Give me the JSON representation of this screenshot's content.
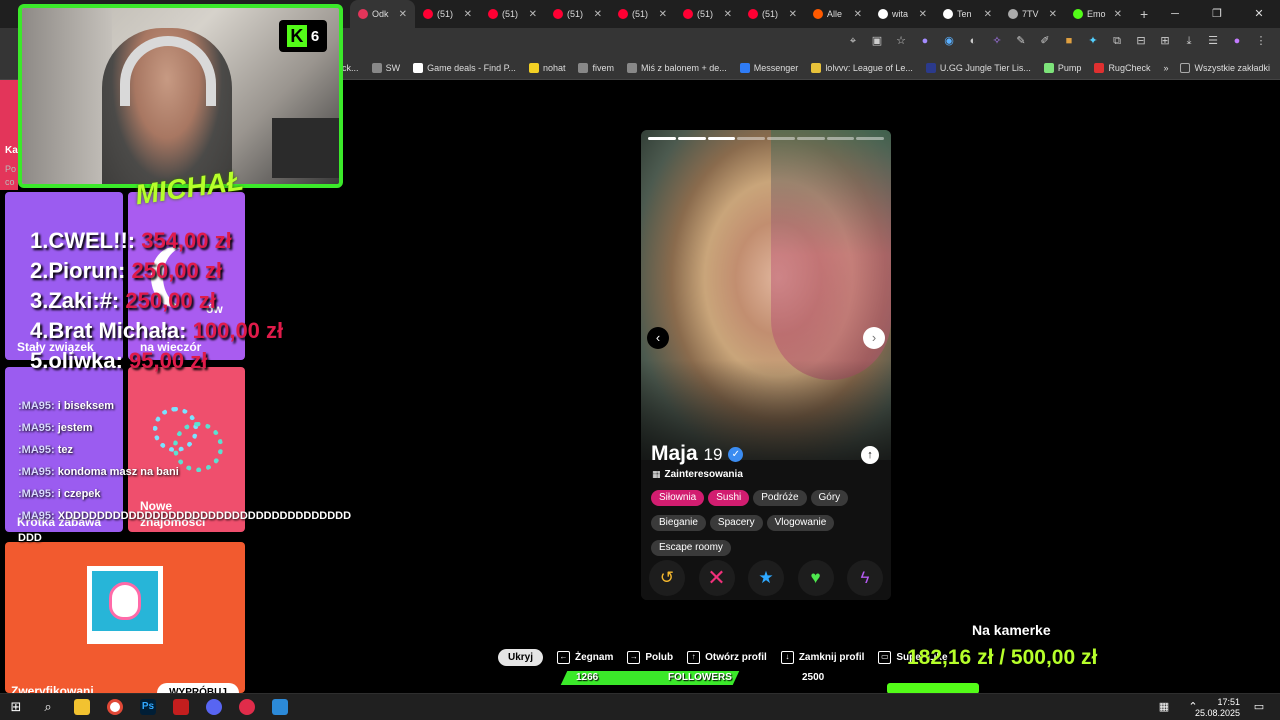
{
  "tabs": [
    {
      "label": "Odk",
      "color": "#e3355a",
      "active": true
    },
    {
      "label": "(51)",
      "color": "#ff0033"
    },
    {
      "label": "(51)",
      "color": "#ff0033"
    },
    {
      "label": "(51)",
      "color": "#ff0033"
    },
    {
      "label": "(51)",
      "color": "#ff0033"
    },
    {
      "label": "(51)",
      "color": "#ff0033"
    },
    {
      "label": "(51)",
      "color": "#ff0033"
    },
    {
      "label": "Alle",
      "color": "#ff5a00"
    },
    {
      "label": "wita",
      "color": "#ffffff"
    },
    {
      "label": "Ten",
      "color": "#ffffff"
    },
    {
      "label": "7TV",
      "color": "#aaaaaa"
    },
    {
      "label": "Emo",
      "color": "#53fc18"
    }
  ],
  "bookmarks": [
    {
      "label": "lock...",
      "color": "#888888"
    },
    {
      "label": "SW",
      "color": "#888888"
    },
    {
      "label": "Game deals - Find P...",
      "color": "#ffffff"
    },
    {
      "label": "nohat",
      "color": "#f2d024"
    },
    {
      "label": "fivem",
      "color": "#888888"
    },
    {
      "label": "Miś z balonem + de...",
      "color": "#888888"
    },
    {
      "label": "Messenger",
      "color": "#2f7cf6"
    },
    {
      "label": "lolvvv: League of Le...",
      "color": "#e8c23a"
    },
    {
      "label": "U.GG Jungle Tier Lis...",
      "color": "#2b3a8c"
    },
    {
      "label": "Pump",
      "color": "#7de37a"
    },
    {
      "label": "RugCheck",
      "color": "#e03030"
    }
  ],
  "bookmarks_all": "Wszystkie zakładki",
  "left_cards": {
    "card1": "Stały związek",
    "card2_line1": "na wieczór",
    "card2_top": "ów",
    "card3": "Krótka zabawa",
    "card4_line1": "Nowe",
    "card4_line2": "znajomości",
    "card5": "Zweryfikowani",
    "card5_btn": "WYPRÓBUJ",
    "edge_label1": "Ka",
    "edge_label2": "Po",
    "edge_label3": "co"
  },
  "webcam": {
    "kick_count": "6",
    "kick_letter": "K"
  },
  "logo": "MICHAŁ",
  "leaderboard": [
    {
      "name": "1.CWEL!!:",
      "amount": "354,00 zł"
    },
    {
      "name": "2.Piorun:",
      "amount": "250,00 zł"
    },
    {
      "name": "3.Zaki:#:",
      "amount": "250,00 zł"
    },
    {
      "name": "4.Brat Michała:",
      "amount": "100,00 zł"
    },
    {
      "name": "5.oliwka:",
      "amount": "95,00 zł"
    }
  ],
  "chat": [
    {
      "user": ":MA95:",
      "text": " i biseksem"
    },
    {
      "user": ":MA95:",
      "text": " jestem"
    },
    {
      "user": ":MA95:",
      "text": " tez"
    },
    {
      "user": ":MA95:",
      "text": " kondoma masz na bani"
    },
    {
      "user": ":MA95:",
      "text": " i czepek"
    },
    {
      "user": ":MA95:",
      "text": " XDDDDDDDDDDDDDDDDDDDDDDDDDDDDDDDDDDDD"
    },
    {
      "user": "",
      "text": "DDD"
    }
  ],
  "profile": {
    "name": "Maja",
    "age": "19",
    "verified_glyph": "✓",
    "interests_title": "Zainteresowania",
    "tags": [
      {
        "label": "Siłownia",
        "hot": true
      },
      {
        "label": "Sushi",
        "hot": true
      },
      {
        "label": "Podróże",
        "hot": false
      },
      {
        "label": "Góry",
        "hot": false
      },
      {
        "label": "Bieganie",
        "hot": false
      },
      {
        "label": "Spacery",
        "hot": false
      },
      {
        "label": "Vlogowanie",
        "hot": false
      },
      {
        "label": "Escape roomy",
        "hot": false
      }
    ],
    "photo_count": 8,
    "photo_index": 3
  },
  "commands": {
    "hide": "Ukryj",
    "items": [
      {
        "key": "←",
        "label": "Żegnam"
      },
      {
        "key": "→",
        "label": "Polub"
      },
      {
        "key": "↑",
        "label": "Otwórz profil"
      },
      {
        "key": "↓",
        "label": "Zamknij profil"
      },
      {
        "key": "▭",
        "label": "Super Like"
      }
    ]
  },
  "followers": {
    "current": "1266",
    "label": "FOLLOWERS",
    "goal": "2500",
    "progress": 0.5064
  },
  "goal": {
    "title": "Na kamerke",
    "amount": "182,16 zł / 500,00 zł",
    "progress": 0.364
  },
  "taskbar": {
    "time": "17:51",
    "date": "25.08.2025"
  }
}
